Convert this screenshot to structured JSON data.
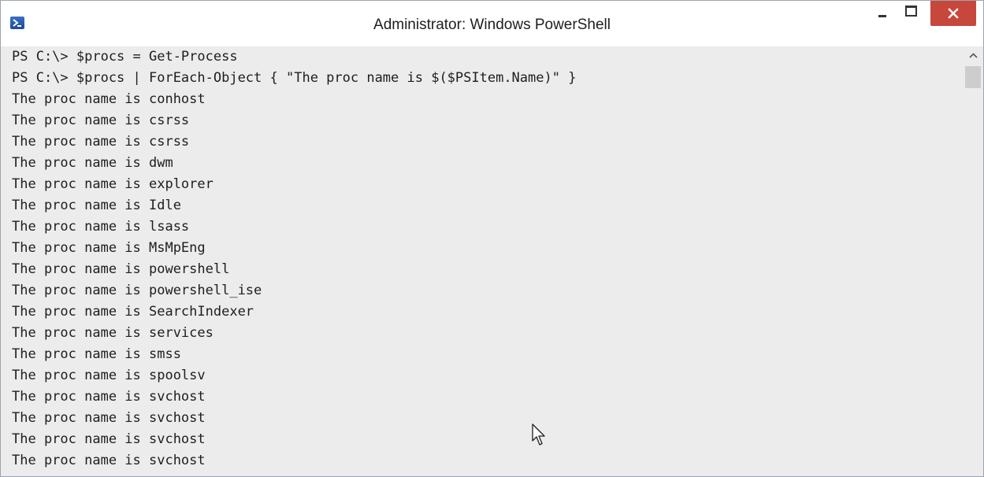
{
  "window": {
    "title": "Administrator: Windows PowerShell"
  },
  "console": {
    "lines": [
      "PS C:\\> $procs = Get-Process",
      "PS C:\\> $procs | ForEach-Object { \"The proc name is $($PSItem.Name)\" }",
      "The proc name is conhost",
      "The proc name is csrss",
      "The proc name is csrss",
      "The proc name is dwm",
      "The proc name is explorer",
      "The proc name is Idle",
      "The proc name is lsass",
      "The proc name is MsMpEng",
      "The proc name is powershell",
      "The proc name is powershell_ise",
      "The proc name is SearchIndexer",
      "The proc name is services",
      "The proc name is smss",
      "The proc name is spoolsv",
      "The proc name is svchost",
      "The proc name is svchost",
      "The proc name is svchost",
      "The proc name is svchost"
    ]
  },
  "icons": {
    "app": "powershell-icon",
    "minimize": "minimize-icon",
    "maximize": "maximize-icon",
    "close": "close-icon",
    "scroll_up": "chevron-up-icon",
    "pointer": "mouse-cursor-icon"
  },
  "colors": {
    "console_bg": "#ececec",
    "console_text": "#1e1e1e",
    "close_button": "#c7473d",
    "icon_blue": "#2a5db0"
  }
}
